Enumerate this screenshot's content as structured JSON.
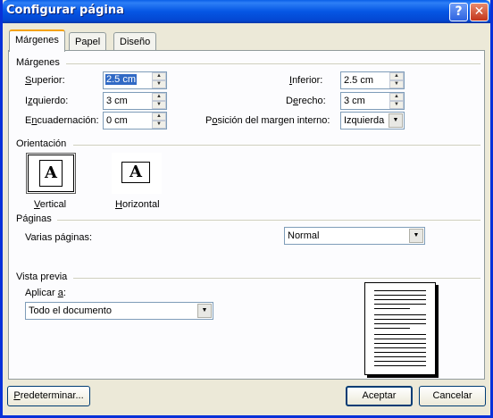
{
  "window": {
    "title": "Configurar página"
  },
  "titlebar": {
    "help_label": "?",
    "close_label": "✕"
  },
  "tabs": [
    {
      "label": "Márgenes"
    },
    {
      "label": "Papel"
    },
    {
      "label": "Diseño"
    }
  ],
  "margins": {
    "group_label": "Márgenes",
    "superior": {
      "label_u": "S",
      "label_rest": "uperior:",
      "value": "2.5 cm"
    },
    "izquierdo": {
      "label_pre": "I",
      "label_u": "z",
      "label_rest": "quierdo:",
      "value": "3 cm"
    },
    "encuadernacion": {
      "label_pre": "E",
      "label_u": "n",
      "label_rest": "cuadernación:",
      "value": "0 cm"
    },
    "inferior": {
      "label_u": "I",
      "label_rest": "nferior:",
      "value": "2.5 cm"
    },
    "derecho": {
      "label_pre": "D",
      "label_u": "e",
      "label_rest": "recho:",
      "value": "3 cm"
    },
    "posicion": {
      "label_pre": "P",
      "label_u": "o",
      "label_rest": "sición del margen interno:",
      "value": "Izquierda"
    }
  },
  "orientation": {
    "group_label": "Orientación",
    "icon_letter": "A",
    "vertical": {
      "label_u": "V",
      "label_rest": "ertical"
    },
    "horizontal": {
      "label_u": "H",
      "label_rest": "orizontal"
    }
  },
  "pages": {
    "group_label": "Páginas",
    "multiple_label_pre": "Varias pá",
    "multiple_label_u": "g",
    "multiple_label_rest": "inas:",
    "multiple_value": "Normal"
  },
  "preview": {
    "group_label": "Vista previa",
    "apply_label_pre": "Aplicar ",
    "apply_label_u": "a",
    "apply_label_rest": ":",
    "apply_value": "Todo el documento"
  },
  "buttons": {
    "default_u": "P",
    "default_rest": "redeterminar...",
    "ok": "Aceptar",
    "cancel": "Cancelar"
  },
  "colors": {
    "titlebar": "#0556e4",
    "dialog_bg": "#ece9d8",
    "selection": "#316ac5",
    "tab_highlight": "#f5a20b"
  }
}
